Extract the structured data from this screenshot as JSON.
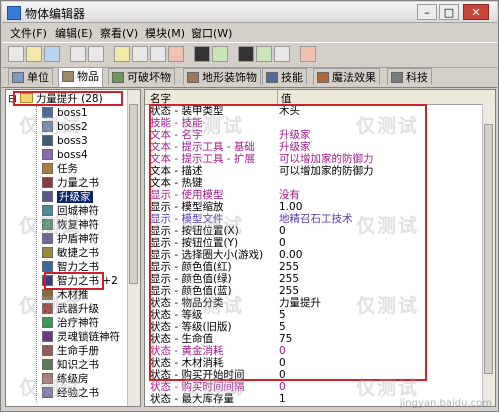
{
  "window": {
    "title": "物体编辑器",
    "min": "–",
    "max": "□",
    "close": "✕"
  },
  "menu": [
    "文件(F)",
    "编辑(E)",
    "察看(V)",
    "模块(M)",
    "窗口(W)"
  ],
  "toolbar_icons": [
    "new-file-icon",
    "open-folder-icon",
    "save-icon",
    "copy-icon",
    "paste-icon",
    "text-a-icon",
    "sound-icon",
    "grid-icon",
    "pin-icon",
    "box-icon",
    "monitor-icon",
    "pen-icon",
    "book-icon",
    "tools-icon",
    "settings-icon"
  ],
  "tabs": [
    {
      "label": "单位",
      "icon_color": "#7a9cc7"
    },
    {
      "label": "物品",
      "icon_color": "#9a8a6a",
      "active": true
    },
    {
      "label": "可破坏物",
      "icon_color": "#6a9a5a"
    },
    {
      "label": "地形装饰物",
      "icon_color": "#9a7a5a"
    },
    {
      "label": "技能",
      "icon_color": "#5a6a9a"
    },
    {
      "label": "魔法效果",
      "icon_color": "#b06a3a"
    },
    {
      "label": "科技",
      "icon_color": "#7a7a7a"
    }
  ],
  "tree": {
    "root": {
      "expander": "⊟",
      "label": "力量提升",
      "count": "(28)"
    },
    "items": [
      {
        "label": "boss1",
        "icon": "#4a6a9a"
      },
      {
        "label": "boss2",
        "icon": "#6a8ab0"
      },
      {
        "label": "boss3",
        "icon": "#3a5a7a"
      },
      {
        "label": "boss4",
        "icon": "#8a6ab0"
      },
      {
        "label": "任务",
        "icon": "#b07a3a"
      },
      {
        "label": "力量之书",
        "icon": "#8a3a3a"
      },
      {
        "label": "升级家",
        "icon": "#5a5a8a",
        "selected": true
      },
      {
        "label": "回城神符",
        "icon": "#4a8a9a"
      },
      {
        "label": "恢复神符",
        "icon": "#4a9a6a"
      },
      {
        "label": "护盾神符",
        "icon": "#6a6a9a"
      },
      {
        "label": "敏捷之书",
        "icon": "#9a8a3a"
      },
      {
        "label": "智力之书",
        "icon": "#3a6a9a"
      },
      {
        "label": "智力之书 +2",
        "icon": "#3a3a8a"
      },
      {
        "label": "木材推",
        "icon": "#8a6a3a"
      },
      {
        "label": "武器升级",
        "icon": "#9a3a3a"
      },
      {
        "label": "治疗神符",
        "icon": "#3a9a5a"
      },
      {
        "label": "灵魂锁链神符",
        "icon": "#6a3a8a"
      },
      {
        "label": "生命手册",
        "icon": "#9a5a5a"
      },
      {
        "label": "知识之书",
        "icon": "#5a7a5a"
      },
      {
        "label": "练级房",
        "icon": "#b07a7a"
      },
      {
        "label": "经验之书",
        "icon": "#7a7ab0"
      }
    ]
  },
  "grid": {
    "col_name": "名字",
    "col_value": "值",
    "rows": [
      {
        "name": "状态 - 装甲类型",
        "value": "木头",
        "style": "blue"
      },
      {
        "name": "技能 - 技能",
        "value": "",
        "style": "pink"
      },
      {
        "name": "文本 - 名字",
        "value": "升级家",
        "style": "pink"
      },
      {
        "name": "文本 - 提示工具 - 基础",
        "value": "升级家",
        "style": "pink"
      },
      {
        "name": "文本 - 提示工具 - 扩展",
        "value": "可以增加家的防御力",
        "style": "pink"
      },
      {
        "name": "文本 - 描述",
        "value": "可以增加家的防御力",
        "style": "blue"
      },
      {
        "name": "文本 - 热键",
        "value": "",
        "style": "blue"
      },
      {
        "name": "显示 - 使用模型",
        "value": "没有",
        "style": "pink"
      },
      {
        "name": "显示 - 模型缩放",
        "value": "1.00",
        "style": "blue"
      },
      {
        "name": "显示 - 模型文件",
        "value": "地精召石工技术",
        "style": "purple"
      },
      {
        "name": "显示 - 按钮位置(X)",
        "value": "0",
        "style": "blue"
      },
      {
        "name": "显示 - 按钮位置(Y)",
        "value": "0",
        "style": "blue"
      },
      {
        "name": "显示 - 选择圈大小(游戏)",
        "value": "0.00",
        "style": "blue"
      },
      {
        "name": "显示 - 颜色值(红)",
        "value": "255",
        "style": "blue"
      },
      {
        "name": "显示 - 颜色值(绿)",
        "value": "255",
        "style": "blue"
      },
      {
        "name": "显示 - 颜色值(蓝)",
        "value": "255",
        "style": "blue"
      },
      {
        "name": "状态 - 物品分类",
        "value": "力量提升",
        "style": "blue"
      },
      {
        "name": "状态 - 等级",
        "value": "5",
        "style": "blue"
      },
      {
        "name": "状态 - 等级(旧版)",
        "value": "5",
        "style": "blue"
      },
      {
        "name": "状态 - 生命值",
        "value": "75",
        "style": "blue"
      },
      {
        "name": "状态 - 黄金消耗",
        "value": "0",
        "style": "pink"
      },
      {
        "name": "状态 - 木材消耗",
        "value": "0",
        "style": "blue"
      },
      {
        "name": "状态 - 购买开始时间",
        "value": "0",
        "style": "blue"
      },
      {
        "name": "状态 - 购买时间间隔",
        "value": "0",
        "style": "pink"
      },
      {
        "name": "状态 - 最大库存量",
        "value": "1",
        "style": "blue"
      }
    ]
  },
  "watermarks": [
    "仅测试",
    "仅测试",
    "仅测试",
    "仅测试",
    "仅测试",
    "仅测试",
    "仅测试",
    "仅测试",
    "仅测试",
    "仅测试",
    "仅测试",
    "仅测试"
  ],
  "watermark_url": "jingyan.baidu.com"
}
